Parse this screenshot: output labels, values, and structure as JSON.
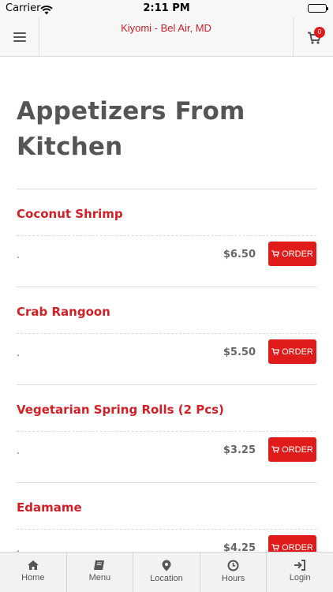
{
  "status_bar": {
    "carrier": "Carrier",
    "time": "2:11 PM"
  },
  "header": {
    "title": "Kiyomi - Bel Air, MD",
    "cart_count": "0"
  },
  "category": {
    "title": "Appetizers From Kitchen"
  },
  "items": [
    {
      "name": "Coconut Shrimp",
      "description": ".",
      "price": "$6.50",
      "order_label": "ORDER"
    },
    {
      "name": "Crab Rangoon",
      "description": ".",
      "price": "$5.50",
      "order_label": "ORDER"
    },
    {
      "name": "Vegetarian Spring Rolls (2 Pcs)",
      "description": ".",
      "price": "$3.25",
      "order_label": "ORDER"
    },
    {
      "name": "Edamame",
      "description": ".",
      "price": "$4.25",
      "order_label": "ORDER"
    }
  ],
  "tabs": [
    {
      "label": "Home",
      "icon": "home-icon"
    },
    {
      "label": "Menu",
      "icon": "book-icon"
    },
    {
      "label": "Location",
      "icon": "map-marker-icon"
    },
    {
      "label": "Hours",
      "icon": "clock-icon"
    },
    {
      "label": "Login",
      "icon": "sign-in-icon"
    }
  ],
  "colors": {
    "accent": "#e01b1b",
    "title_red": "#d32027",
    "header_bg": "#f7f7f7",
    "tab_bg": "#f2f2f2"
  }
}
